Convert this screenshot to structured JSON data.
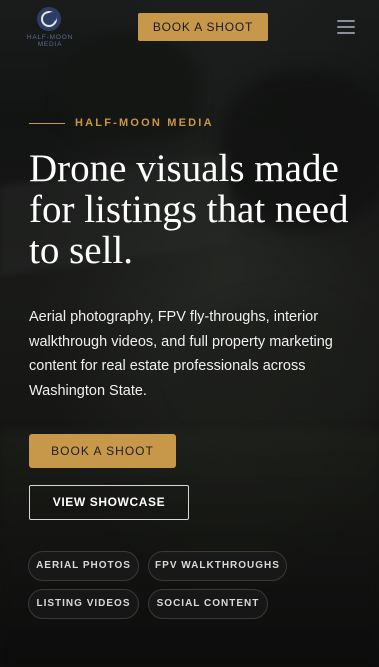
{
  "brand": {
    "logo_text": "HALF-MOON MEDIA",
    "accent_color": "#c7984a"
  },
  "header": {
    "cta_label": "BOOK A SHOOT",
    "menu_icon": "hamburger-menu-icon"
  },
  "hero": {
    "eyebrow": "HALF-MOON MEDIA",
    "headline": "Drone visuals made for listings that need to sell.",
    "description": "Aerial photography, FPV fly-throughs, interior walkthrough videos, and full property marketing content for real estate professionals across Washington State.",
    "primary_cta": "BOOK A SHOOT",
    "secondary_cta": "VIEW SHOWCASE"
  },
  "tags": [
    {
      "label": "AERIAL PHOTOS"
    },
    {
      "label": "FPV WALKTHROUGHS"
    },
    {
      "label": "LISTING VIDEOS"
    },
    {
      "label": "SOCIAL CONTENT"
    }
  ]
}
